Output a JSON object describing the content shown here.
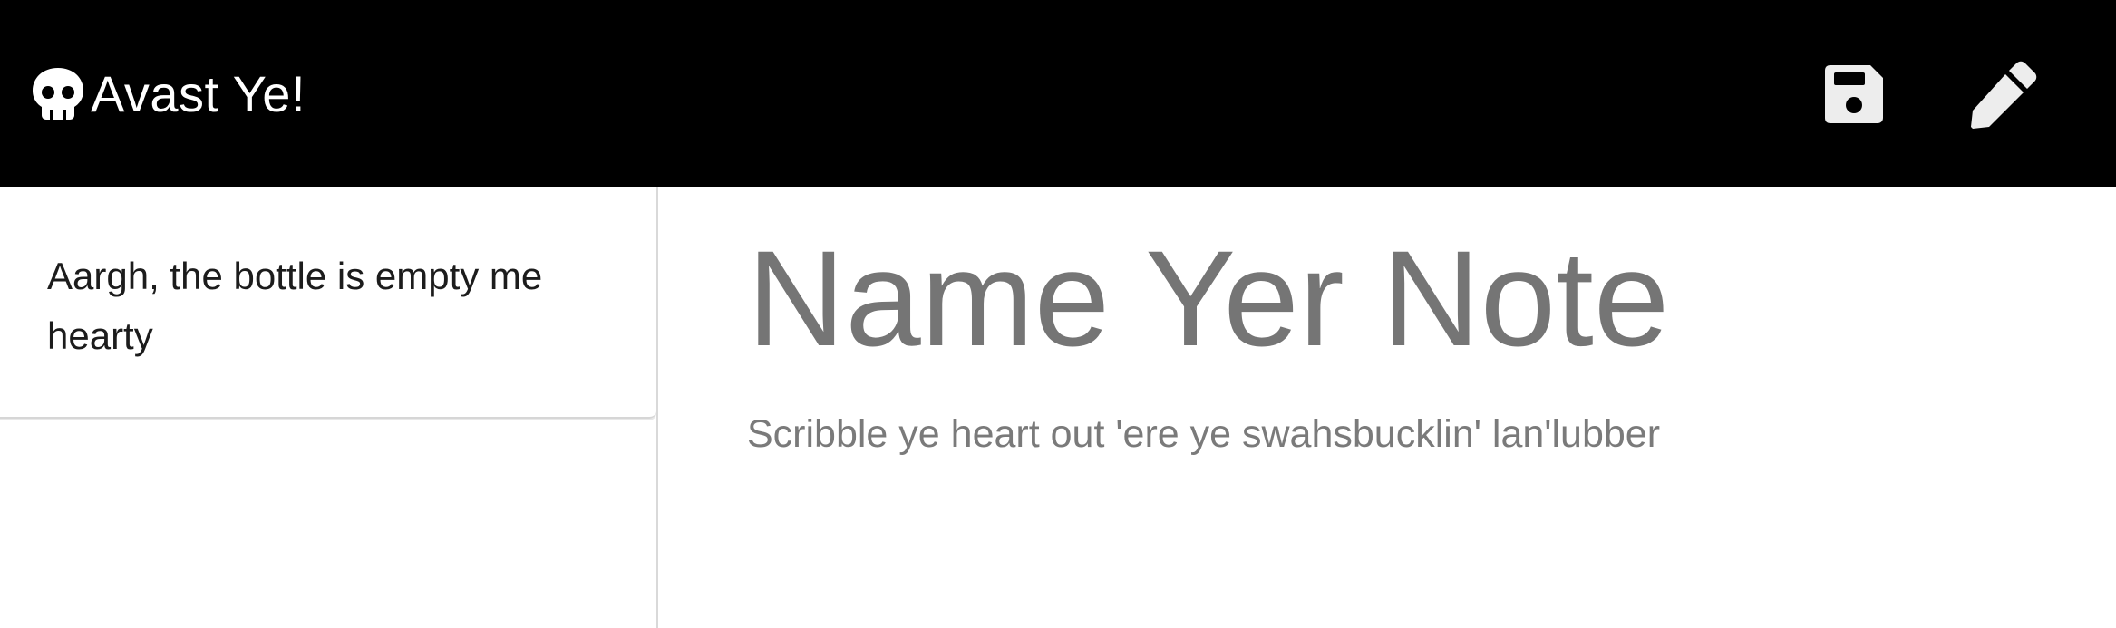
{
  "app": {
    "title": "Avast Ye!",
    "logo_icon": "skull-icon"
  },
  "toolbar": {
    "save_icon": "floppy-disk-icon",
    "edit_icon": "pencil-icon",
    "background": "#000000",
    "icon_color": "#ededed"
  },
  "sidebar": {
    "notes": [
      {
        "text": "Aargh, the bottle is empty me hearty"
      }
    ]
  },
  "editor": {
    "title_placeholder": "Name Yer Note",
    "body_placeholder": "Scribble ye heart out 'ere ye swahsbucklin' lan'lubber",
    "text_color": "#757575"
  }
}
